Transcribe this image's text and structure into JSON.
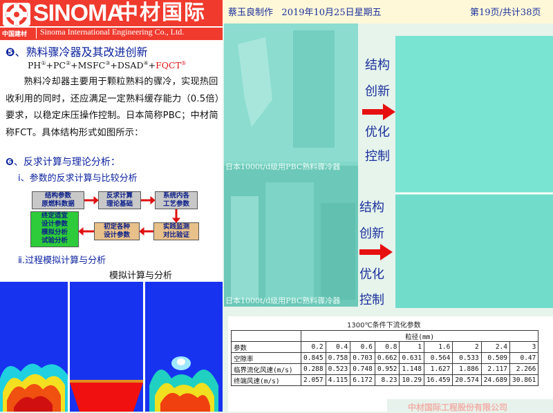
{
  "header": {
    "brand_en": "SINOMA",
    "brand_cn": "中材国际",
    "brand_small": "中国建材",
    "brand_sub": "Sinoma International Engineering   Co., Ltd.",
    "author": "蔡玉良制作",
    "date": "2019年10月25日星期五",
    "page": "第19页/共计38页"
  },
  "section5": {
    "number": "❺",
    "title": "、熟料骤冷器及其改进创新",
    "formula": {
      "p1": "PH",
      "s1": "①",
      "p2": "+PC",
      "s2": "②",
      "p3": "+MSFC",
      "s3": "③",
      "p4": "+DSAD",
      "s4": "④",
      "p5": "+",
      "p6": "FQCT",
      "s6": "⑤"
    },
    "paragraph": "熟料冷却器主要用于颗粒熟料的骤冷，实现热回收利用的同时，还应满足一定熟料缓存能力（0.5倍）要求，以稳定床压操作控制。日本简称PBC；中材简称FCT。具体结构形式如图所示："
  },
  "section6": {
    "number": "❻",
    "title": "、反求计算与理论分析：",
    "sub1": "ⅰ、参数的反求计算与比较分析",
    "sub2": "ⅱ.过程模拟计算与分析",
    "sim_title": "模拟计算与分析"
  },
  "flow": {
    "box1": "结构参数\n原燃料数据",
    "box2": "反求计算\n理论基础",
    "box3": "系统内各\n工艺参数",
    "box4": "实践监测\n对比验证",
    "box5": "初定各种\n设计参数",
    "box6": "终定适宜\n设计参数\n模拟分析\n试验分析"
  },
  "photo": {
    "caption_top": "日本1000t/d级用PBC熟料骤冷器",
    "caption_bottom": "日本1000t/d级用PBC熟料骤冷器"
  },
  "right_labels": {
    "top": [
      "结构",
      "创新",
      "优化",
      "控制"
    ],
    "bottom": [
      "结构",
      "创新",
      "优化",
      "控制"
    ]
  },
  "table": {
    "title": "1300℃条件下流化参数",
    "size_header": "粒径(mm)",
    "param_label": "参数",
    "sizes": [
      "0.2",
      "0.4",
      "0.6",
      "0.8",
      "1",
      "1.6",
      "2",
      "2.4",
      "3"
    ],
    "rows": [
      {
        "label": "空隙率",
        "values": [
          "0.845",
          "0.758",
          "0.703",
          "0.662",
          "0.631",
          "0.564",
          "0.533",
          "0.509",
          "0.47"
        ]
      },
      {
        "label": "临界流化风速(m/s)",
        "values": [
          "0.288",
          "0.523",
          "0.748",
          "0.952",
          "1.148",
          "1.627",
          "1.886",
          "2.117",
          "2.266"
        ]
      },
      {
        "label": "终端风速(m/s)",
        "values": [
          "2.057",
          "4.115",
          "6.172",
          "8.23",
          "10.29",
          "16.459",
          "20.574",
          "24.689",
          "30.861"
        ]
      }
    ]
  },
  "footer": "中材国际工程股份有限公司"
}
